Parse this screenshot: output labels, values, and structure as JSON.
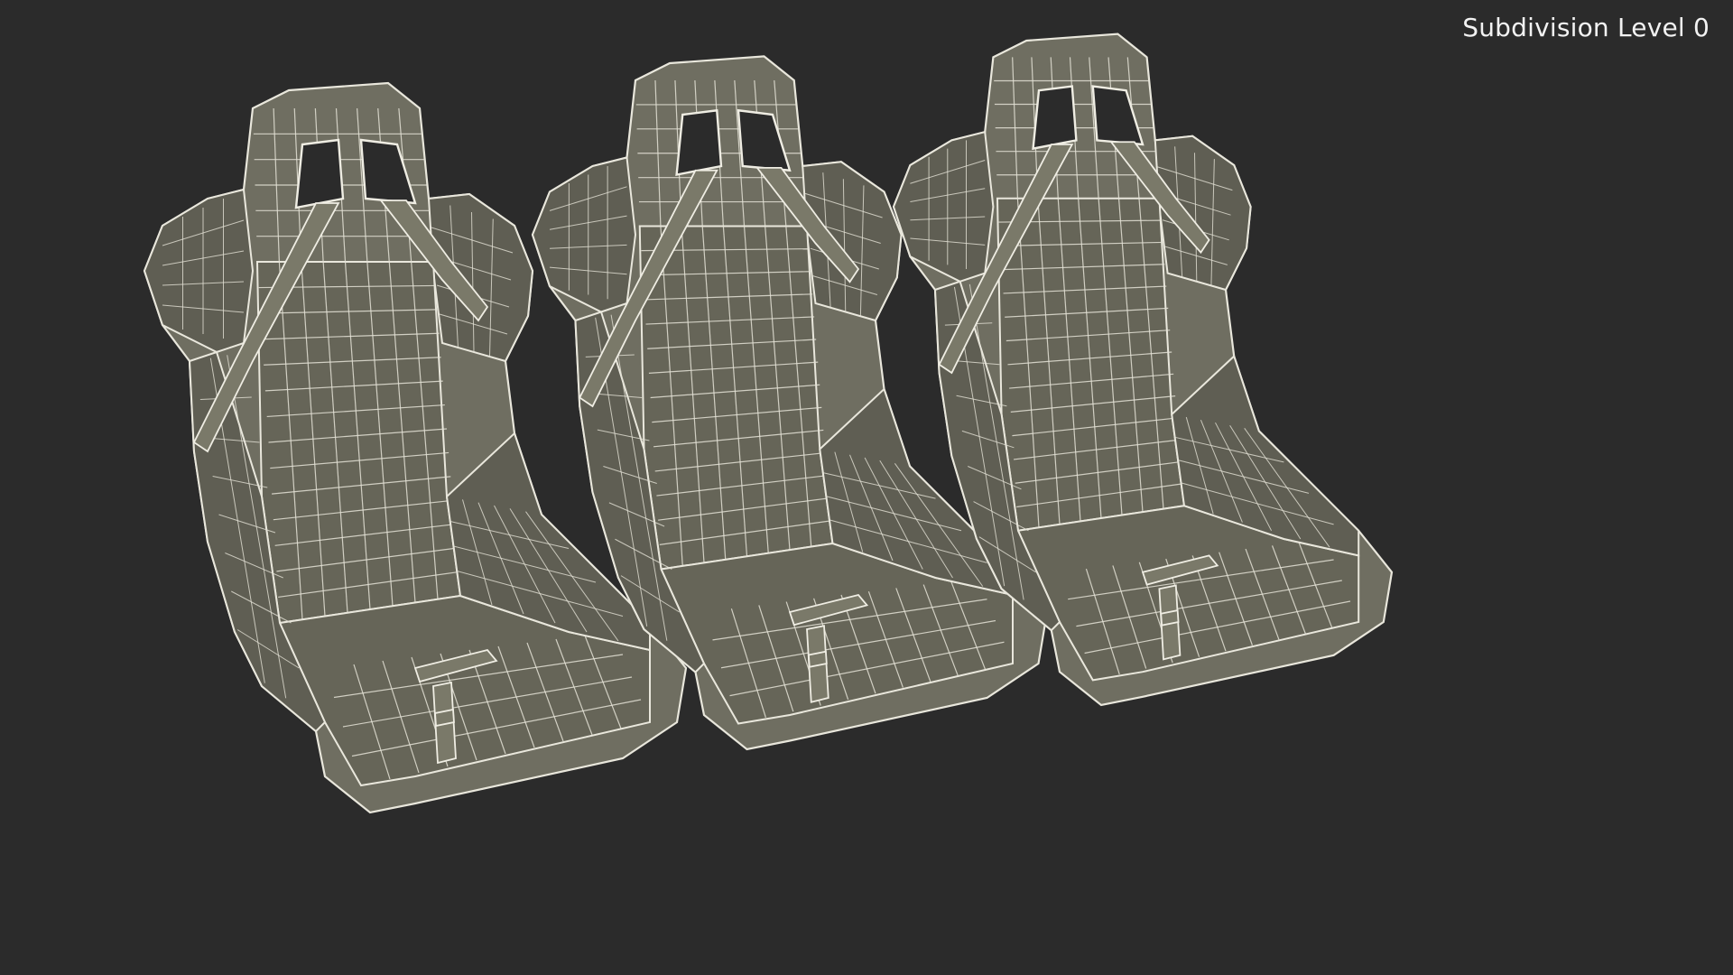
{
  "viewport": {
    "subdivision_label": "Subdivision Level 0"
  },
  "scene": {
    "objects": [
      {
        "name": "seat-left"
      },
      {
        "name": "seat-middle"
      },
      {
        "name": "seat-right"
      }
    ]
  },
  "colors": {
    "background": "#2b2b2b",
    "mesh_fill": "#6f6e61",
    "wireframe": "#e9e7dc",
    "label_text": "#f2f2f2"
  }
}
